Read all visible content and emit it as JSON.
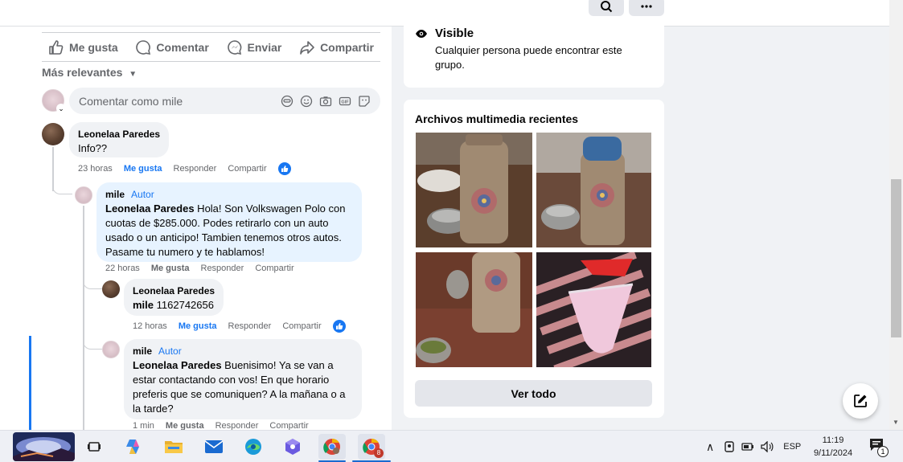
{
  "feed": {
    "actions": {
      "like": "Me gusta",
      "comment": "Comentar",
      "send": "Enviar",
      "share": "Compartir"
    },
    "sort_label": "Más relevantes",
    "comment_placeholder": "Comentar como mile",
    "comments": [
      {
        "author": "Leonelaa Paredes",
        "text": "Info??",
        "time": "23 horas",
        "like": "Me gusta",
        "reply": "Responder",
        "share": "Compartir",
        "liked": true
      },
      {
        "author": "mile",
        "badge": "Autor",
        "mention": "Leonelaa Paredes",
        "text_lines": [
          " Hola! Son Volkswagen Polo con",
          "cuotas de $285.000. Podes retirarlo con un auto",
          "usado o un anticipo! Tambien tenemos otros autos.",
          "Pasame tu numero y te hablamos!"
        ],
        "time": "22 horas",
        "like": "Me gusta",
        "reply": "Responder",
        "share": "Compartir"
      },
      {
        "author": "Leonelaa Paredes",
        "mention": "mile",
        "text": " 1162742656",
        "time": "12 horas",
        "like": "Me gusta",
        "reply": "Responder",
        "share": "Compartir",
        "liked": true
      },
      {
        "author": "mile",
        "badge": "Autor",
        "mention": "Leonelaa Paredes",
        "text_lines": [
          " Buenisimo! Ya se van a",
          "estar contactando con vos! En que horario",
          "preferis que se comuniquen? A la mañana o a",
          "la tarde?"
        ],
        "time": "1 min",
        "like": "Me gusta",
        "reply": "Responder",
        "share": "Compartir"
      }
    ]
  },
  "sidebar": {
    "privacy": {
      "title": "Visible",
      "description_lines": [
        "Cualquier persona puede encontrar este",
        "grupo."
      ]
    },
    "media": {
      "title": "Archivos multimedia recientes",
      "see_all": "Ver todo"
    }
  },
  "taskbar": {
    "language": "ESP",
    "time": "11:19",
    "date": "9/11/2024",
    "notification_count": "1",
    "chrome_badge": "8"
  },
  "colors": {
    "accent": "#1877f2",
    "author_bubble": "#e7f3ff",
    "bubble": "#f0f2f5"
  }
}
